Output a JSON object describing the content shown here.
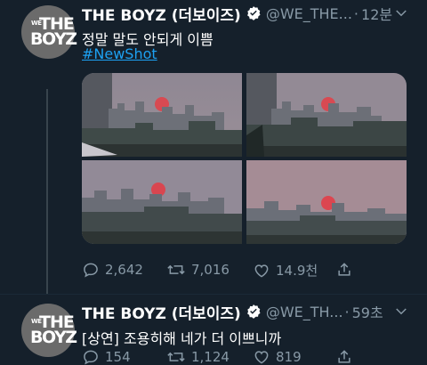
{
  "tweets": [
    {
      "name": "THE BOYZ (더보이즈)",
      "handle": "@WE_THE...",
      "dot": "·",
      "time": "12분",
      "text": "정말 말도 안되게 이쁨",
      "hashtag": "#NewShot",
      "avatar": {
        "line0": "WE",
        "line1": "THE",
        "line2": "BOYZ"
      },
      "media_photos": [
        {
          "label": "sunset-over-city-1"
        },
        {
          "label": "sunset-over-city-2"
        },
        {
          "label": "sunset-over-city-3"
        },
        {
          "label": "sunset-over-city-4"
        }
      ],
      "actions": {
        "replies": "2,642",
        "retweets": "7,016",
        "likes": "14.9천"
      }
    },
    {
      "name": "THE BOYZ (더보이즈)",
      "handle": "@WE_TH...",
      "dot": "·",
      "time": "59초",
      "text": "[상연] 조용히해 네가 더 이쁘니까",
      "avatar": {
        "line0": "WE",
        "line1": "THE",
        "line2": "BOYZ"
      },
      "actions": {
        "replies": "154",
        "retweets": "1,124",
        "likes": "819"
      }
    }
  ],
  "colors": {
    "background": "#15202b",
    "secondary_text": "#8899a6",
    "link": "#1da1f2",
    "verified": "#ffffff"
  },
  "icons": [
    "reply-icon",
    "retweet-icon",
    "like-icon",
    "share-icon",
    "verified-badge-icon",
    "chevron-down-icon"
  ]
}
